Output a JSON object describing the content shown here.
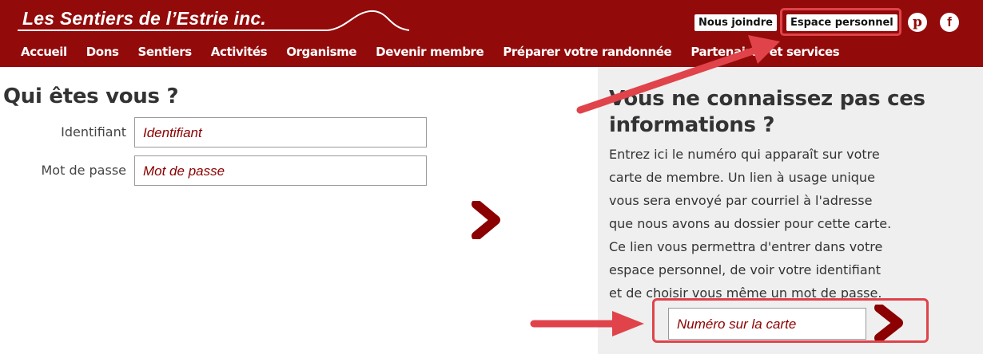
{
  "header": {
    "logo": "Les Sentiers de l’Estrie inc.",
    "util_links": [
      "Nous joindre",
      "Espace personnel"
    ],
    "social": {
      "pinterest": "p",
      "facebook": "f"
    },
    "nav": [
      "Accueil",
      "Dons",
      "Sentiers",
      "Activités",
      "Organisme",
      "Devenir membre",
      "Préparer votre randonnée",
      "Partenaires et services"
    ]
  },
  "login": {
    "title": "Qui êtes vous ?",
    "identifiant_label": "Identifiant",
    "identifiant_placeholder": "Identifiant",
    "password_label": "Mot de passe",
    "password_placeholder": "Mot de passe"
  },
  "help": {
    "title": "Vous ne connaissez pas ces informations ?",
    "text": "Entrez ici le numéro qui apparaît sur votre carte de membre. Un lien à usage unique vous sera envoyé par courriel à l'adresse que nous avons au dossier pour cette carte. Ce lien vous permettra d'entrer dans votre espace personnel, de voir votre identifiant et de choisir vous même un mot de passe.",
    "card_placeholder": "Numéro sur la carte"
  },
  "icons": {
    "submit": "chevron-right-icon",
    "annotation": "arrow-icon"
  },
  "colors": {
    "brand": "#930a0a",
    "highlight": "#e0434a",
    "panel": "#efefef"
  }
}
